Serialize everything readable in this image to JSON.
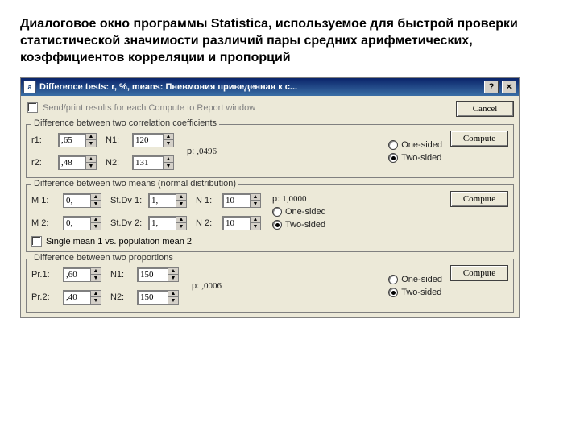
{
  "caption": "Диалоговое окно программы Statistica, используемое для быстрой проверки статистической значимости различий пары средних арифметических, коэффициентов корреляции и пропорций",
  "titlebar": {
    "icon_letter": "a",
    "title": "Difference tests: r, %, means: Пневмония приведенная к с...",
    "help": "?",
    "close": "×"
  },
  "check_send": "Send/print results for each Compute to Report window",
  "cancel": "Cancel",
  "compute": "Compute",
  "radios": {
    "one": "One-sided",
    "two": "Two-sided"
  },
  "groups": {
    "corr": {
      "title": "Difference between two correlation coefficients",
      "r1": {
        "label": "r1:",
        "value": ",65"
      },
      "r2": {
        "label": "r2:",
        "value": ",48"
      },
      "n1": {
        "label": "N1:",
        "value": "120"
      },
      "n2": {
        "label": "N2:",
        "value": "131"
      },
      "p_label": "p:",
      "p_value": ",0496",
      "side": "two"
    },
    "means": {
      "title": "Difference between two means (normal distribution)",
      "m1": {
        "label": "M 1:",
        "value": "0,"
      },
      "m2": {
        "label": "M 2:",
        "value": "0,"
      },
      "sd1": {
        "label": "St.Dv 1:",
        "value": "1,"
      },
      "sd2": {
        "label": "St.Dv 2:",
        "value": "1,"
      },
      "n1": {
        "label": "N 1:",
        "value": "10"
      },
      "n2": {
        "label": "N 2:",
        "value": "10"
      },
      "p_label": "p:",
      "p_value": "1,0000",
      "single_label": "Single mean 1 vs. population mean 2",
      "side": "two"
    },
    "props": {
      "title": "Difference between two proportions",
      "p1": {
        "label": "Pr.1:",
        "value": ",60"
      },
      "p2": {
        "label": "Pr.2:",
        "value": ",40"
      },
      "n1": {
        "label": "N1:",
        "value": "150"
      },
      "n2": {
        "label": "N2:",
        "value": "150"
      },
      "p_label": "p:",
      "p_value": ",0006",
      "side": "two"
    }
  }
}
